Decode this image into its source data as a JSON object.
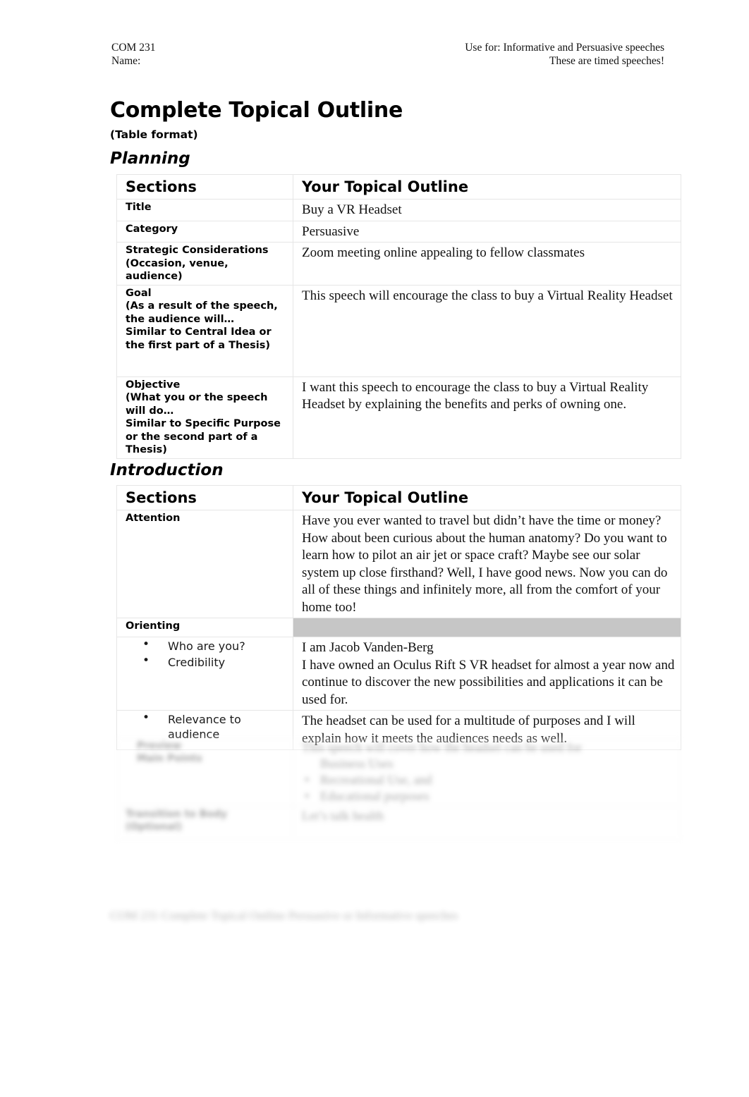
{
  "document": {
    "header": {
      "course_code": "COM 231",
      "name_label": "Name:",
      "use_for": "Use for: Informative and Persuasive speeches",
      "timed_note": "These are timed speeches!"
    },
    "title": "Complete Topical Outline",
    "subtitle": "(Table format)"
  },
  "planning": {
    "heading": "Planning",
    "columns": {
      "sections": "Sections",
      "outline": "Your Topical Outline"
    },
    "rows": [
      {
        "label": "Title",
        "note": "",
        "value": "Buy a VR Headset"
      },
      {
        "label": "Category",
        "note": "",
        "value": "Persuasive"
      },
      {
        "label": "Strategic Considerations",
        "note": "(Occasion, venue, audience)",
        "value": "Zoom meeting online appealing to fellow classmates"
      },
      {
        "label": "Goal",
        "note": "(As a result of the speech, the audience will…\nSimilar to Central Idea or the first part of a Thesis)",
        "value": "This speech will encourage the class to buy a Virtual Reality Headset"
      },
      {
        "label": "Objective",
        "note": "(What you or the speech will do…\nSimilar to Specific Purpose or the second part of a Thesis)",
        "value": "I want this speech to encourage the class to buy a Virtual Reality Headset by explaining the benefits and perks of owning one."
      }
    ]
  },
  "introduction": {
    "heading": "Introduction",
    "columns": {
      "sections": "Sections",
      "outline": "Your Topical Outline"
    },
    "attention": {
      "label": "Attention",
      "value": "Have you ever wanted to travel but didn’t have the time or money? How about been curious about the human anatomy? Do you want to learn how to pilot an air jet or space craft? Maybe see our solar system up close firsthand? Well, I have good news. Now you can do all of these things and infinitely more, all from the comfort of your home too!"
    },
    "orienting": {
      "label": "Orienting",
      "bullets": [
        {
          "text": "Who are you?",
          "value": "I am Jacob Vanden-Berg"
        },
        {
          "text": "Credibility",
          "value": "I have owned an Oculus Rift S VR headset for almost a year now and continue to discover the new possibilities and applications it can be used for."
        },
        {
          "text": "Relevance to audience",
          "value": "The headset can be used for a multitude of purposes and I will explain how it meets the audiences needs as well."
        }
      ]
    },
    "faded": {
      "row_label": "Preview",
      "row_note": "Main Points",
      "row_value": "This speech will cover how the headset can be used for",
      "sub_value": "Business Uses",
      "bullets": [
        "Recreational Use, and",
        "Educational purposes"
      ],
      "last_label": "Transition to Body",
      "last_note": "(Optional)",
      "last_value": "Let’s talk health"
    },
    "faded_footer": "COM 231 Complete Topical Outline  Persuasive or Informative speeches"
  }
}
